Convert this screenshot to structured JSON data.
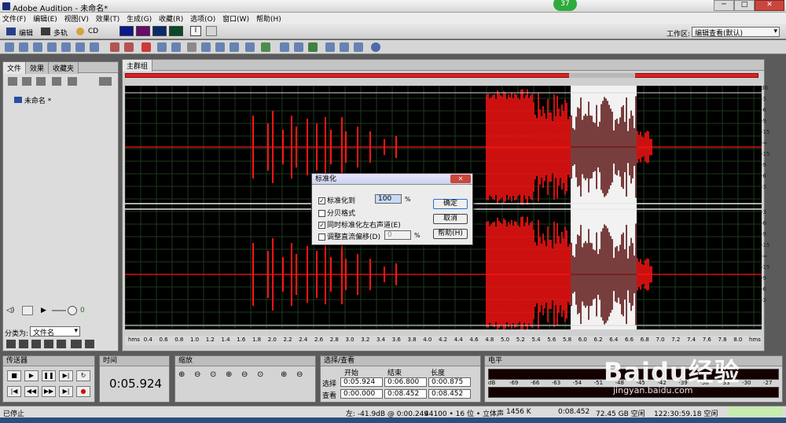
{
  "window": {
    "title": "Adobe Audition - 未命名*"
  },
  "badge": {
    "count": "37"
  },
  "menu": [
    "文件(F)",
    "编辑(E)",
    "视图(V)",
    "效果(T)",
    "生成(G)",
    "收藏(R)",
    "选项(O)",
    "窗口(W)",
    "帮助(H)"
  ],
  "modes": [
    "编辑",
    "多轨",
    "CD"
  ],
  "workspace": {
    "label": "工作区:",
    "value": "编辑查看(默认)"
  },
  "left_panel": {
    "tabs": [
      "文件",
      "效果",
      "收藏夹"
    ],
    "file_item": "未命名 *",
    "sort_label": "分类为:",
    "sort_value": "文件名",
    "counter": "0"
  },
  "main_panel": {
    "tab": "主群组",
    "db_labels": [
      "dB",
      "-3",
      "-6",
      "-9",
      "-15",
      "-∞",
      "-15",
      "-9",
      "-6",
      "-3"
    ],
    "time_labels": [
      "hms",
      "0.4",
      "0.6",
      "0.8",
      "1.0",
      "1.2",
      "1.4",
      "1.6",
      "1.8",
      "2.0",
      "2.2",
      "2.4",
      "2.6",
      "2.8",
      "3.0",
      "3.2",
      "3.4",
      "3.6",
      "3.8",
      "4.0",
      "4.2",
      "4.4",
      "4.6",
      "4.8",
      "5.0",
      "5.2",
      "5.4",
      "5.6",
      "5.8",
      "6.0",
      "6.2",
      "6.4",
      "6.6",
      "6.8",
      "7.0",
      "7.2",
      "7.4",
      "7.6",
      "7.8",
      "8.0",
      "hms"
    ]
  },
  "dialog": {
    "title": "标准化",
    "normalize_to_label": "标准化到",
    "normalize_value": "100",
    "percent": "%",
    "decibel_label": "分贝格式",
    "stereo_label": "同时标准化左右声道(E)",
    "dc_label": "调整直流偏移(D)",
    "dc_value": "0",
    "dc_percent": "%",
    "ok": "确定",
    "cancel": "取消",
    "help": "帮助(H)"
  },
  "transport": {
    "title": "传送器"
  },
  "time_panel": {
    "title": "时间",
    "value": "0:05.924"
  },
  "zoom_panel": {
    "title": "缩放"
  },
  "selection_panel": {
    "title": "选择/查看",
    "headers": [
      "开始",
      "结束",
      "长度"
    ],
    "select_label": "选择",
    "view_label": "查看",
    "select_values": [
      "0:05.924",
      "0:06.800",
      "0:00.875"
    ],
    "view_values": [
      "0:00.000",
      "0:08.452",
      "0:08.452"
    ]
  },
  "level_panel": {
    "title": "电平",
    "scale": [
      "dB",
      "-69",
      "-66",
      "-63",
      "-54",
      "-51",
      "-48",
      "-45",
      "-42",
      "-39",
      "-36",
      "-33",
      "-30",
      "-27"
    ]
  },
  "status": {
    "state": "已停止",
    "level": "左: -41.9dB @ 0:00.249",
    "format": "44100 • 16 位 • 立体声",
    "size": "1456 K",
    "duration": "0:08.452",
    "free": "72.45 GB 空闲",
    "free_time": "122:30:59.18 空闲"
  },
  "watermark": {
    "logo": "Baidu经验",
    "url": "jingyan.baidu.com"
  },
  "colors": {
    "waveform": "#ff1414",
    "selection_wave": "#5a1010",
    "selection_bg": "#f2f2f2",
    "grid": "#1e3a1e"
  }
}
